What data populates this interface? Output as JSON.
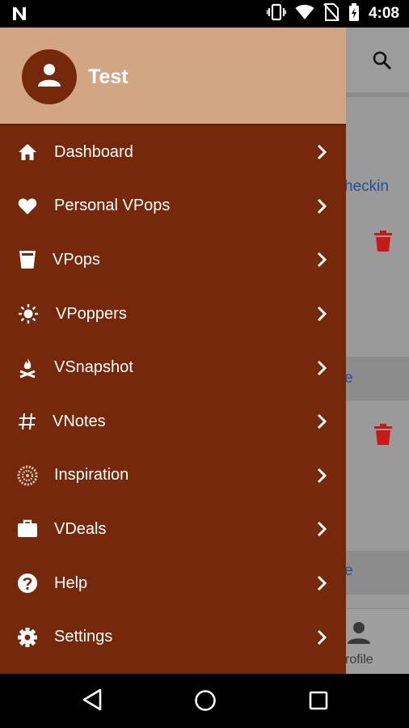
{
  "status_bar": {
    "time": "4:08",
    "left_icon": "n-notification-icon",
    "icons": [
      "vibrate-icon",
      "wifi-icon",
      "no-sim-icon",
      "battery-icon"
    ]
  },
  "background": {
    "search_icon": "search-icon",
    "link_1": "heckin",
    "link_2": "e",
    "link_3": "e",
    "trash_icon": "trash-icon",
    "trash_color": "#c81818",
    "bottom_nav_label": "rofile",
    "bottom_nav_icon": "person-icon"
  },
  "drawer": {
    "header_color": "#d3a683",
    "background_color": "#76290a",
    "user": {
      "name": "Test",
      "avatar_icon": "person-icon"
    },
    "items": [
      {
        "label": "Dashboard",
        "icon": "home-icon"
      },
      {
        "label": "Personal VPops",
        "icon": "heart-icon"
      },
      {
        "label": "VPops",
        "icon": "cup-icon"
      },
      {
        "label": "VPoppers",
        "icon": "sun-icon"
      },
      {
        "label": "VSnapshot",
        "icon": "campfire-icon"
      },
      {
        "label": "VNotes",
        "icon": "hash-icon"
      },
      {
        "label": "Inspiration",
        "icon": "gear-flower-icon"
      },
      {
        "label": "VDeals",
        "icon": "briefcase-icon"
      },
      {
        "label": "Help",
        "icon": "help-icon"
      },
      {
        "label": "Settings",
        "icon": "settings-icon"
      }
    ]
  },
  "nav_bar": {
    "buttons": [
      "back-icon",
      "home-circle-icon",
      "recents-icon"
    ]
  }
}
